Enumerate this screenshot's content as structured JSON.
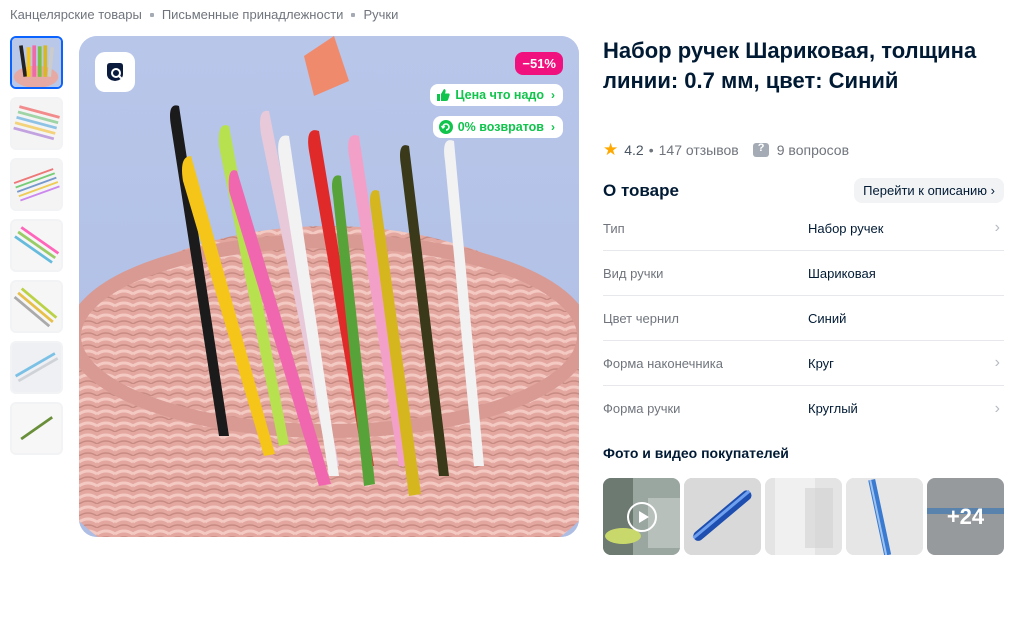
{
  "breadcrumb": [
    "Канцелярские товары",
    "Письменные принадлежности",
    "Ручки"
  ],
  "product": {
    "title": "Набор ручек Шариковая, толщина линии: 0.7 мм, цвет: Синий",
    "discount": "−51%",
    "chip_price": "Цена что надо",
    "chip_returns": "0% возвратов"
  },
  "rating": {
    "score": "4.2",
    "reviews": "147 отзывов",
    "questions": "9 вопросов"
  },
  "about": {
    "heading": "О товаре",
    "link": "Перейти к описанию"
  },
  "specs": [
    {
      "key": "Тип",
      "value": "Набор ручек"
    },
    {
      "key": "Вид ручки",
      "value": "Шариковая"
    },
    {
      "key": "Цвет чернил",
      "value": "Синий"
    },
    {
      "key": "Форма наконечника",
      "value": "Круг"
    },
    {
      "key": "Форма ручки",
      "value": "Круглый"
    }
  ],
  "ugc": {
    "title": "Фото и видео покупателей",
    "more": "+24"
  },
  "colors": {
    "accent": "#0a63ff",
    "discount": "#f1117e",
    "success": "#10c44c",
    "star": "#ffa800"
  }
}
